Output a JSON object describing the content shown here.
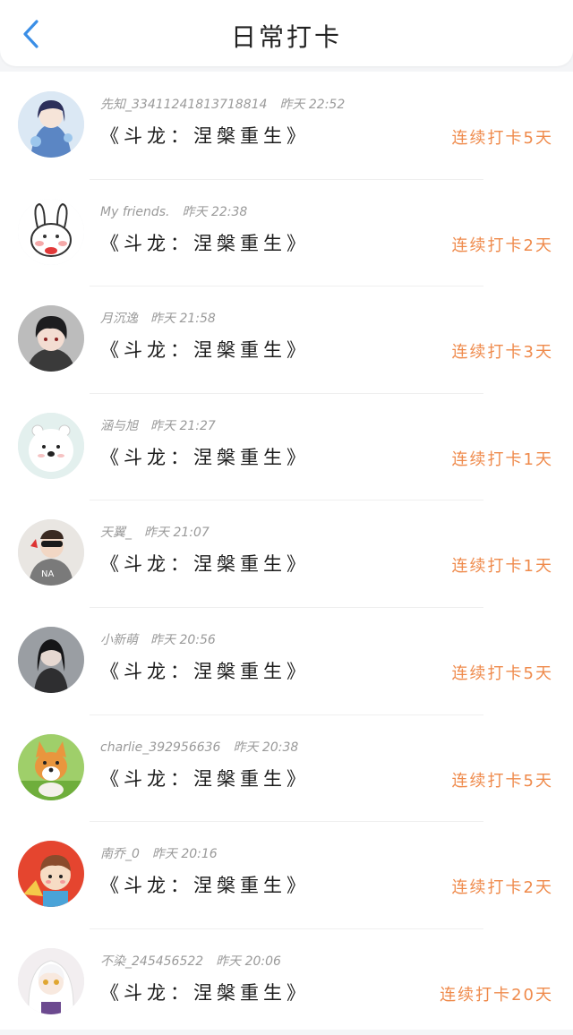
{
  "header": {
    "title": "日常打卡",
    "back_icon": "chevron-left-icon",
    "accent": "#3a8ee6"
  },
  "colors": {
    "streak": "#ef8a4b",
    "meta": "#9a9a9a"
  },
  "items": [
    {
      "user": "先知_33411241813718814",
      "time": "昨天 22:52",
      "book": "《斗龙：涅槃重生》",
      "streak": "连续打卡5天",
      "avatar": "anime-girl-avatar"
    },
    {
      "user": "My friends.",
      "time": "昨天 22:38",
      "book": "《斗龙：涅槃重生》",
      "streak": "连续打卡2天",
      "avatar": "bunny-avatar"
    },
    {
      "user": "月沉逸",
      "time": "昨天 21:58",
      "book": "《斗龙：涅槃重生》",
      "streak": "连续打卡3天",
      "avatar": "anime-boy-avatar"
    },
    {
      "user": "涵与旭",
      "time": "昨天 21:27",
      "book": "《斗龙：涅槃重生》",
      "streak": "连续打卡1天",
      "avatar": "polar-bear-avatar"
    },
    {
      "user": "天翼_",
      "time": "昨天 21:07",
      "book": "《斗龙：涅槃重生》",
      "streak": "连续打卡1天",
      "avatar": "cartoon-boy-avatar"
    },
    {
      "user": "小新萌",
      "time": "昨天 20:56",
      "book": "《斗龙：涅槃重生》",
      "streak": "连续打卡5天",
      "avatar": "dark-hair-girl-avatar"
    },
    {
      "user": "charlie_392956636",
      "time": "昨天 20:38",
      "book": "《斗龙：涅槃重生》",
      "streak": "连续打卡5天",
      "avatar": "corgi-avatar"
    },
    {
      "user": "南乔_0",
      "time": "昨天 20:16",
      "book": "《斗龙：涅槃重生》",
      "streak": "连续打卡2天",
      "avatar": "cartoon-kid-avatar"
    },
    {
      "user": "不染_245456522",
      "time": "昨天 20:06",
      "book": "《斗龙：涅槃重生》",
      "streak": "连续打卡20天",
      "avatar": "white-hair-girl-avatar"
    }
  ]
}
